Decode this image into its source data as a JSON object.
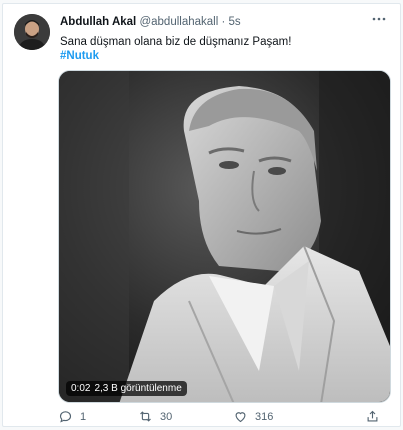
{
  "tweet": {
    "author_name": "Abdullah Akal",
    "handle": "@abdullahakall",
    "separator": "·",
    "time": "5s",
    "text": "Sana düşman olana biz de düşmanız Paşam!",
    "hashtag": "#Nutuk"
  },
  "media": {
    "duration": "0:02",
    "views": "2,3 B görüntülenme"
  },
  "actions": {
    "reply_count": "1",
    "retweet_count": "30",
    "like_count": "316"
  },
  "icons": {
    "more": "more-icon",
    "reply": "reply-icon",
    "retweet": "retweet-icon",
    "like": "heart-icon",
    "share": "share-icon"
  },
  "colors": {
    "link": "#1d9bf0",
    "muted": "#536471",
    "border": "#e1e8ed"
  }
}
